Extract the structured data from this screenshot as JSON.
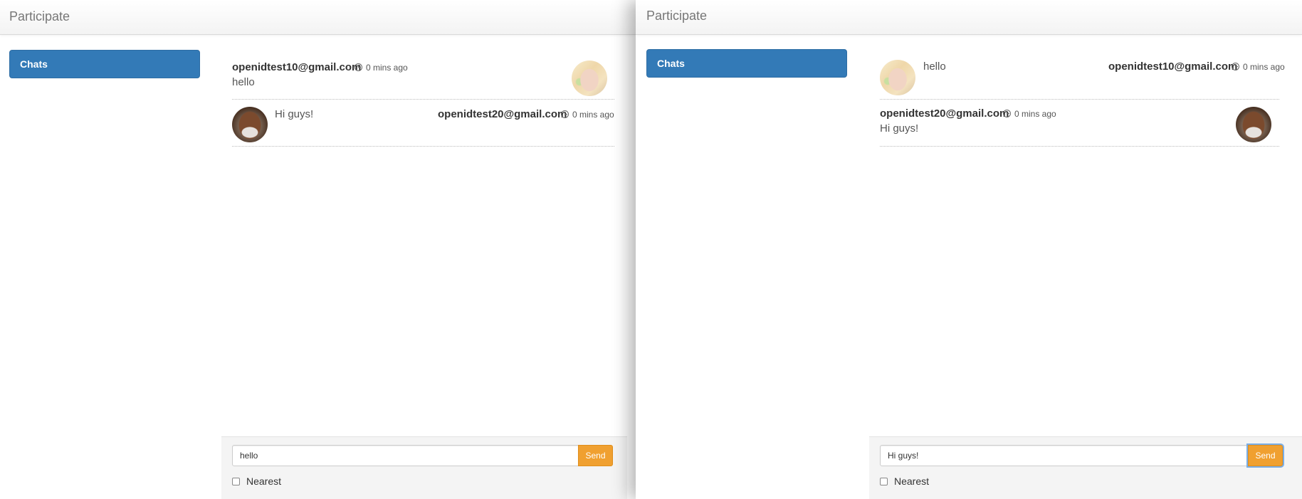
{
  "windows": [
    {
      "brand": "Participate",
      "sidebar": {
        "chats_label": "Chats"
      },
      "messages": [
        {
          "author": "openidtest10@gmail.com",
          "time": "0 mins ago",
          "text": "hello",
          "avatar": "blonde-avatar"
        },
        {
          "author": "openidtest20@gmail.com",
          "time": "0 mins ago",
          "text": "Hi guys!",
          "avatar": "dark-avatar"
        }
      ],
      "composer": {
        "input_value": "hello",
        "send_label": "Send",
        "nearest_label": "Nearest",
        "nearest_checked": false
      }
    },
    {
      "brand": "Participate",
      "sidebar": {
        "chats_label": "Chats"
      },
      "messages": [
        {
          "author": "openidtest10@gmail.com",
          "time": "0 mins ago",
          "text": "hello",
          "avatar": "blonde-avatar"
        },
        {
          "author": "openidtest20@gmail.com",
          "time": "0 mins ago",
          "text": "Hi guys!",
          "avatar": "dark-avatar"
        }
      ],
      "composer": {
        "input_value": "Hi guys!",
        "send_label": "Send",
        "nearest_label": "Nearest",
        "nearest_checked": false
      }
    }
  ],
  "colors": {
    "primary": "#337ab7",
    "send": "#f0a030",
    "navbar": "#f6f6f6"
  }
}
